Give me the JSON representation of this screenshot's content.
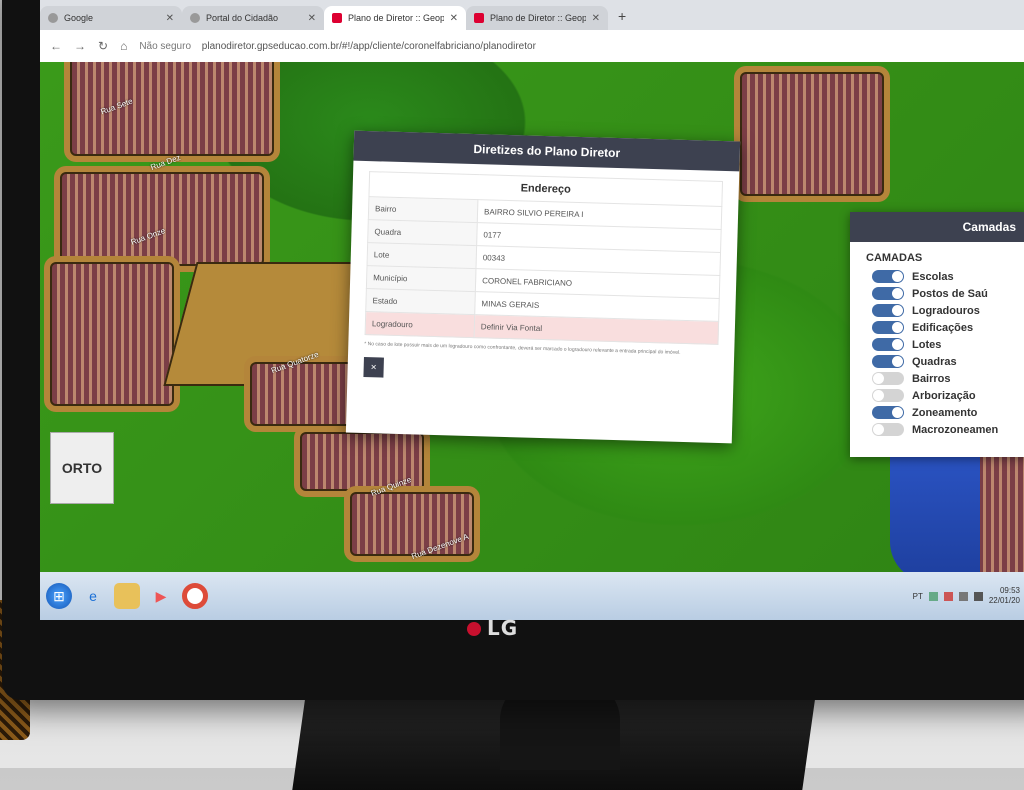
{
  "browser": {
    "tabs": [
      {
        "label": "Google",
        "active": false
      },
      {
        "label": "Portal do Cidadão",
        "active": false
      },
      {
        "label": "Plano de Diretor :: Geopix",
        "active": true
      },
      {
        "label": "Plano de Diretor :: Geopix",
        "active": false
      }
    ],
    "newtab": "+",
    "security": "Não seguro",
    "url": "planodiretor.gpseducao.com.br/#!/app/cliente/coronelfabriciano/planodiretor"
  },
  "modal": {
    "title": "Diretizes do Plano Diretor",
    "section": "Endereço",
    "rows": [
      {
        "key": "Bairro",
        "value": "BAIRRO SILVIO PEREIRA I"
      },
      {
        "key": "Quadra",
        "value": "0177"
      },
      {
        "key": "Lote",
        "value": "00343"
      },
      {
        "key": "Município",
        "value": "CORONEL FABRICIANO"
      },
      {
        "key": "Estado",
        "value": "MINAS GERAIS"
      },
      {
        "key": "Logradouro",
        "value": "Definir Via Fontal"
      }
    ],
    "note": "* No caso de lote possuir mais de um logradouro como confrontante, deverá ser marcado o logradouro relevante a entrada principal do imóvel.",
    "close": "×"
  },
  "layers": {
    "title": "Camadas",
    "subtitle": "CAMADAS",
    "items": [
      {
        "label": "Escolas",
        "on": true
      },
      {
        "label": "Postos de Saú",
        "on": true
      },
      {
        "label": "Logradouros",
        "on": true
      },
      {
        "label": "Edificações",
        "on": true
      },
      {
        "label": "Lotes",
        "on": true
      },
      {
        "label": "Quadras",
        "on": true
      },
      {
        "label": "Bairros",
        "on": false
      },
      {
        "label": "Arborização",
        "on": false
      },
      {
        "label": "Zoneamento",
        "on": true
      },
      {
        "label": "Macrozoneamen",
        "on": false
      }
    ]
  },
  "map": {
    "orto": "ORTO",
    "streets": [
      "Rua Sete",
      "Rua Dez",
      "Rua Quinze",
      "Rua Onze",
      "Rua Quatorze",
      "Rua Dezenove A"
    ]
  },
  "taskbar": {
    "lang": "PT",
    "time": "09:53",
    "date": "22/01/20"
  },
  "monitor": {
    "brand": "LG"
  },
  "colors": {
    "header": "#3d4150",
    "toggle_on": "#3f6aa6",
    "angular": "#dd0031",
    "lg": "#c8102e"
  }
}
